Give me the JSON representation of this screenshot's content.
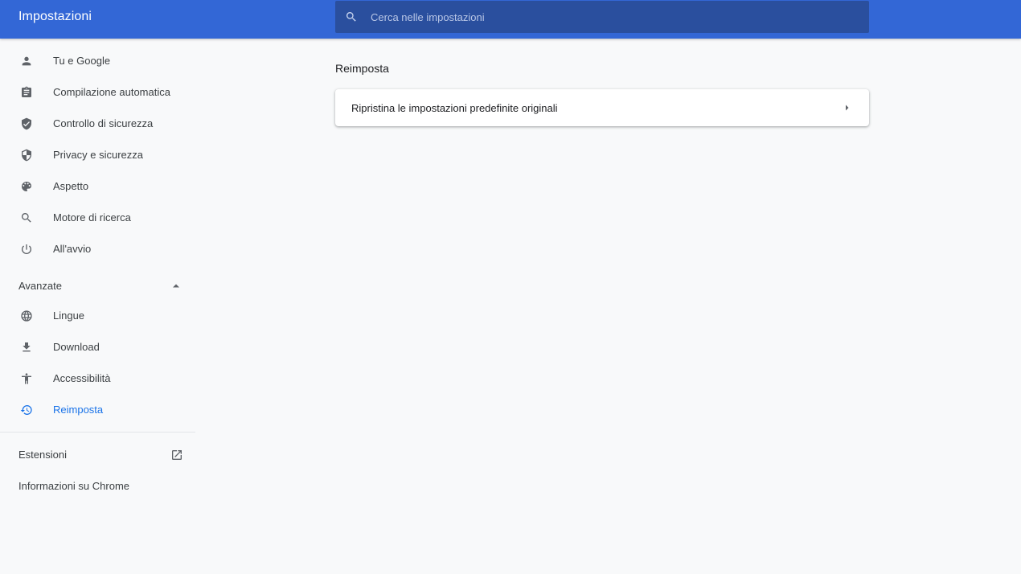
{
  "header": {
    "title": "Impostazioni",
    "search_placeholder": "Cerca nelle impostazioni"
  },
  "sidebar": {
    "items": [
      {
        "label": "Tu e Google",
        "icon": "person-icon"
      },
      {
        "label": "Compilazione automatica",
        "icon": "clipboard-icon"
      },
      {
        "label": "Controllo di sicurezza",
        "icon": "shield-check-icon"
      },
      {
        "label": "Privacy e sicurezza",
        "icon": "shield-icon"
      },
      {
        "label": "Aspetto",
        "icon": "palette-icon"
      },
      {
        "label": "Motore di ricerca",
        "icon": "search-icon"
      },
      {
        "label": "All'avvio",
        "icon": "power-icon"
      }
    ],
    "advanced": {
      "label": "Avanzate",
      "expanded": true,
      "items": [
        {
          "label": "Lingue",
          "icon": "globe-icon"
        },
        {
          "label": "Download",
          "icon": "download-icon"
        },
        {
          "label": "Accessibilità",
          "icon": "accessibility-icon"
        },
        {
          "label": "Reimposta",
          "icon": "restore-icon",
          "active": true
        }
      ]
    },
    "extensions_label": "Estensioni",
    "about_label": "Informazioni su Chrome"
  },
  "main": {
    "section_title": "Reimposta",
    "reset_row_label": "Ripristina le impostazioni predefinite originali"
  },
  "colors": {
    "header_bg": "#3367d6",
    "search_bg": "#2a4f9e",
    "accent": "#1a73e8",
    "icon_gray": "#5f6368",
    "page_bg": "#f8f9fa"
  }
}
